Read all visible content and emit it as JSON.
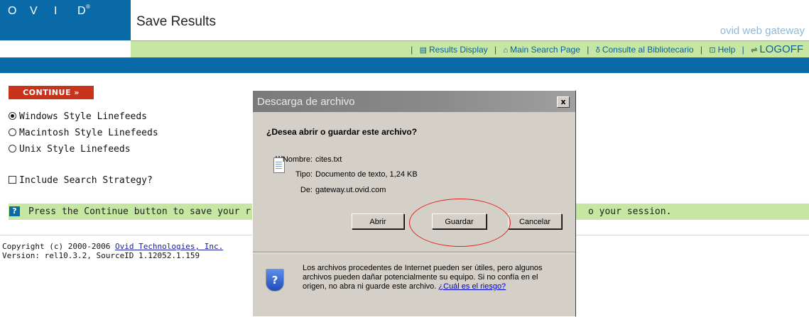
{
  "header": {
    "logo_letters": [
      "O",
      "V",
      "I",
      "D"
    ],
    "logo_mark": "®",
    "page_title": "Save Results",
    "brand": "ovid web gateway"
  },
  "nav": {
    "results_display": "Results Display",
    "main_search_page": "Main Search Page",
    "consulte": "Consulte al Bibliotecario",
    "help": "Help",
    "logoff": "LOGOFF"
  },
  "form": {
    "continue_label": "CONTINUE »",
    "linefeeds": [
      {
        "label": "Windows Style Linefeeds",
        "selected": true
      },
      {
        "label": "Macintosh Style Linefeeds",
        "selected": false
      },
      {
        "label": "Unix Style Linefeeds",
        "selected": false
      }
    ],
    "include_strategy": "Include Search Strategy?"
  },
  "hint": {
    "icon": "?",
    "text_left": "Press the Continue button to save your r",
    "text_right": "o your session."
  },
  "footer": {
    "copyright_prefix": "Copyright (c) 2000-2006 ",
    "company_link": "Ovid Technologies, Inc.",
    "version": "Version: rel10.3.2, SourceID 1.12052.1.159"
  },
  "dialog": {
    "title": "Descarga de archivo",
    "close": "x",
    "question": "¿Desea abrir o guardar este archivo?",
    "name_label": "Nombre:",
    "name_value": "cites.txt",
    "type_label": "Tipo:",
    "type_value": "Documento de texto, 1,24 KB",
    "from_label": "De:",
    "from_value": "gateway.ut.ovid.com",
    "open_button": "Abrir",
    "save_button": "Guardar",
    "cancel_button": "Cancelar",
    "warning_text": "Los archivos procedentes de Internet pueden ser útiles, pero algunos archivos pueden dañar potencialmente su equipo. Si no confía en el origen, no abra ni guarde este archivo. ",
    "warning_link": "¿Cuál es el riesgo?",
    "shield_icon": "?"
  },
  "colors": {
    "ovid_blue": "#0a6aa8",
    "nav_green": "#c6e6a4",
    "continue_red": "#c8331c",
    "highlight_circle": "#e02020"
  }
}
